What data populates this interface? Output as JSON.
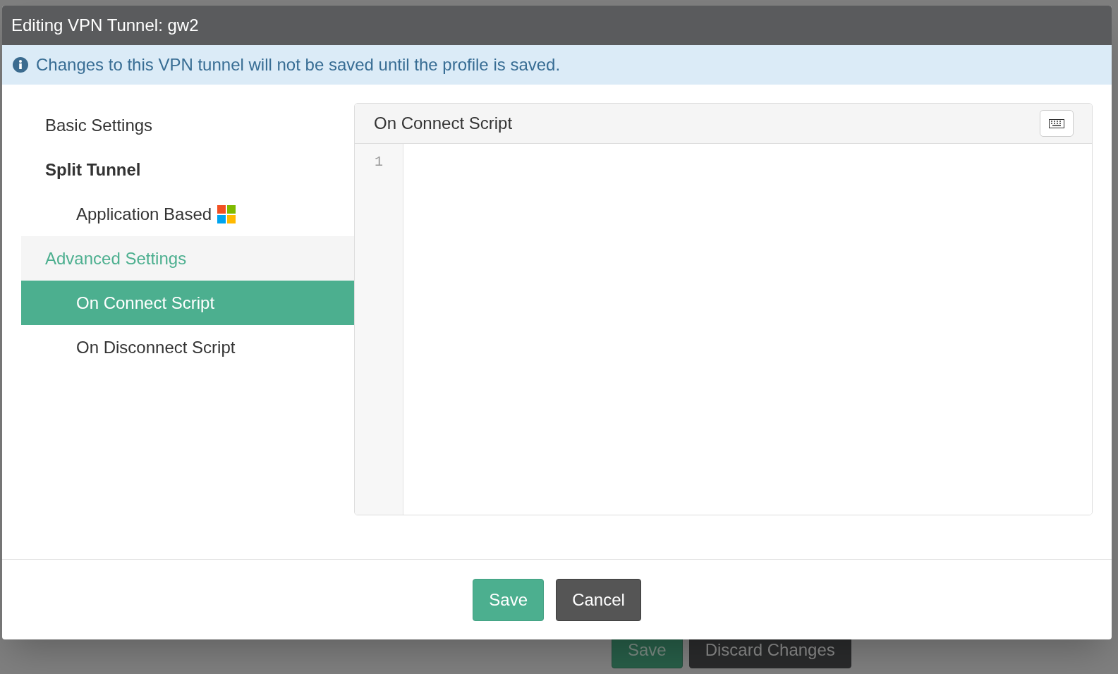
{
  "background": {
    "buttons": [
      {
        "label": "Save",
        "kind": "primary"
      },
      {
        "label": "Discard Changes",
        "kind": "dark"
      }
    ]
  },
  "dialog": {
    "title": "Editing VPN Tunnel: gw2",
    "alert": "Changes to this VPN tunnel will not be saved until the profile is saved.",
    "nav": [
      {
        "label": "Basic Settings",
        "kind": "link",
        "active": false
      },
      {
        "label": "Split Tunnel",
        "kind": "heading",
        "active": false,
        "children": [
          {
            "label": "Application Based",
            "selected": false,
            "windows_icon": true
          }
        ]
      },
      {
        "label": "Advanced Settings",
        "kind": "link",
        "active": true,
        "children": [
          {
            "label": "On Connect Script",
            "selected": true
          },
          {
            "label": "On Disconnect Script",
            "selected": false
          }
        ]
      }
    ],
    "editor": {
      "title": "On Connect Script",
      "line_numbers": [
        "1"
      ]
    },
    "buttons": [
      {
        "label": "Save",
        "kind": "primary"
      },
      {
        "label": "Cancel",
        "kind": "dark"
      }
    ]
  }
}
